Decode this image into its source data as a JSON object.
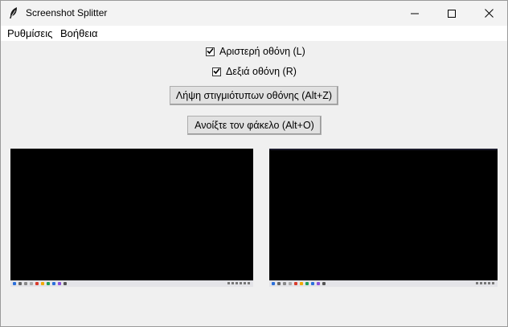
{
  "window": {
    "title": "Screenshot Splitter"
  },
  "menu": {
    "settings_label": "Ρυθμίσεις",
    "help_label": "Βοήθεια"
  },
  "options": {
    "left_screen_label": "Αριστερή οθόνη (L)",
    "left_screen_checked": true,
    "right_screen_label": "Δεξιά οθόνη (R)",
    "right_screen_checked": true
  },
  "actions": {
    "capture_label": "Λήψη στιγμιότυπων οθόνης (Alt+Z)",
    "open_folder_label": "Ανοίξτε τον φάκελο (Alt+O)"
  },
  "icons": {
    "app": "feather-icon",
    "minimize": "minimize-icon",
    "maximize": "maximize-icon",
    "close": "close-icon",
    "check": "checkmark-icon"
  },
  "colors": {
    "window_bg": "#f0f0f0",
    "preview_bg": "#000000",
    "button_bg": "#e1e1e1",
    "taskbar_bg": "#e4e4e8"
  }
}
